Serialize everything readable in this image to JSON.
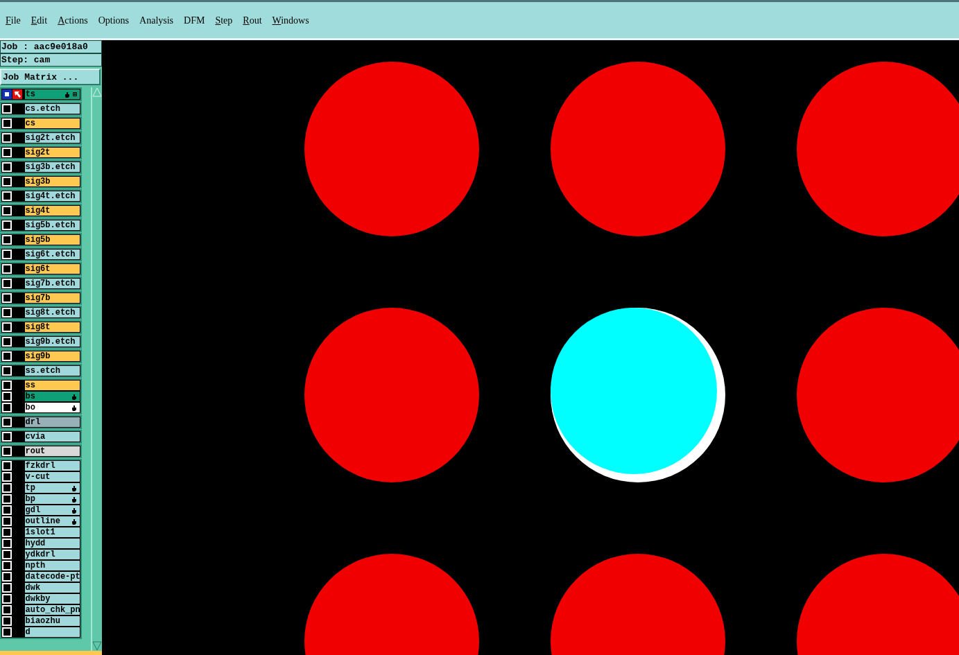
{
  "menu": [
    {
      "label": "File",
      "mnemonic": true
    },
    {
      "label": "Edit",
      "mnemonic": true
    },
    {
      "label": "Actions",
      "mnemonic": true
    },
    {
      "label": "Options",
      "mnemonic": false
    },
    {
      "label": "Analysis",
      "mnemonic": false
    },
    {
      "label": "DFM",
      "mnemonic": false
    },
    {
      "label": "Step",
      "mnemonic": true
    },
    {
      "label": "Rout",
      "mnemonic": true
    },
    {
      "label": "Windows",
      "mnemonic": true
    }
  ],
  "job": "Job : aac9e018a0",
  "step": "Step: cam",
  "matrix_button": "Job Matrix ...",
  "layer_groups": [
    {
      "layers": [
        {
          "name": "ts",
          "color": "#10a078",
          "work_layer": true,
          "hand": true
        }
      ]
    },
    {
      "layers": [
        {
          "name": "cs.etch",
          "color": "#a0d8dc",
          "work_layer": false,
          "hand": false
        }
      ]
    },
    {
      "layers": [
        {
          "name": "cs",
          "color": "#ffc850",
          "work_layer": false,
          "hand": false
        }
      ]
    },
    {
      "layers": [
        {
          "name": "sig2t.etch",
          "color": "#a0d8dc",
          "work_layer": false,
          "hand": false
        }
      ]
    },
    {
      "layers": [
        {
          "name": "sig2t",
          "color": "#ffc850",
          "work_layer": false,
          "hand": false
        }
      ]
    },
    {
      "layers": [
        {
          "name": "sig3b.etch",
          "color": "#a0d8dc",
          "work_layer": false,
          "hand": false
        }
      ]
    },
    {
      "layers": [
        {
          "name": "sig3b",
          "color": "#ffc850",
          "work_layer": false,
          "hand": false
        }
      ]
    },
    {
      "layers": [
        {
          "name": "sig4t.etch",
          "color": "#a0d8dc",
          "work_layer": false,
          "hand": false
        }
      ]
    },
    {
      "layers": [
        {
          "name": "sig4t",
          "color": "#ffc850",
          "work_layer": false,
          "hand": false
        }
      ]
    },
    {
      "layers": [
        {
          "name": "sig5b.etch",
          "color": "#a0d8dc",
          "work_layer": false,
          "hand": false
        }
      ]
    },
    {
      "layers": [
        {
          "name": "sig5b",
          "color": "#ffc850",
          "work_layer": false,
          "hand": false
        }
      ]
    },
    {
      "layers": [
        {
          "name": "sig6t.etch",
          "color": "#a0d8dc",
          "work_layer": false,
          "hand": false
        }
      ]
    },
    {
      "layers": [
        {
          "name": "sig6t",
          "color": "#ffc850",
          "work_layer": false,
          "hand": false
        }
      ]
    },
    {
      "layers": [
        {
          "name": "sig7b.etch",
          "color": "#a0d8dc",
          "work_layer": false,
          "hand": false
        }
      ]
    },
    {
      "layers": [
        {
          "name": "sig7b",
          "color": "#ffc850",
          "work_layer": false,
          "hand": false
        }
      ]
    },
    {
      "layers": [
        {
          "name": "sig8t.etch",
          "color": "#a0d8dc",
          "work_layer": false,
          "hand": false
        }
      ]
    },
    {
      "layers": [
        {
          "name": "sig8t",
          "color": "#ffc850",
          "work_layer": false,
          "hand": false
        }
      ]
    },
    {
      "layers": [
        {
          "name": "sig9b.etch",
          "color": "#a0d8dc",
          "work_layer": false,
          "hand": false
        }
      ]
    },
    {
      "layers": [
        {
          "name": "sig9b",
          "color": "#ffc850",
          "work_layer": false,
          "hand": false
        }
      ]
    },
    {
      "layers": [
        {
          "name": "ss.etch",
          "color": "#a0d8dc",
          "work_layer": false,
          "hand": false
        }
      ]
    },
    {
      "layers": [
        {
          "name": "ss",
          "color": "#ffc850",
          "work_layer": false,
          "hand": false
        },
        {
          "name": "bs",
          "color": "#10a078",
          "work_layer": false,
          "hand": true
        },
        {
          "name": "bo",
          "color": "#ffffff",
          "work_layer": false,
          "hand": true
        }
      ]
    },
    {
      "layers": [
        {
          "name": "drl",
          "color": "#98b0b8",
          "work_layer": false,
          "hand": false
        }
      ]
    },
    {
      "layers": [
        {
          "name": "cvia",
          "color": "#a0d8dc",
          "work_layer": false,
          "hand": false
        }
      ]
    },
    {
      "layers": [
        {
          "name": "rout",
          "color": "#d8d8d8",
          "work_layer": false,
          "hand": false
        }
      ]
    },
    {
      "layers": [
        {
          "name": "fzkdrl",
          "color": "#a0d8dc",
          "work_layer": false,
          "hand": false
        },
        {
          "name": "v-cut",
          "color": "#a0d8dc",
          "work_layer": false,
          "hand": false
        },
        {
          "name": "tp",
          "color": "#a0d8dc",
          "work_layer": false,
          "hand": true
        },
        {
          "name": "bp",
          "color": "#a0d8dc",
          "work_layer": false,
          "hand": true
        },
        {
          "name": "gdl",
          "color": "#a0d8dc",
          "work_layer": false,
          "hand": true
        },
        {
          "name": "outline",
          "color": "#a0d8dc",
          "work_layer": false,
          "hand": true
        },
        {
          "name": "1slot1",
          "color": "#a0d8dc",
          "work_layer": false,
          "hand": false
        },
        {
          "name": "hydd",
          "color": "#a0d8dc",
          "work_layer": false,
          "hand": false
        },
        {
          "name": "ydkdrl",
          "color": "#a0d8dc",
          "work_layer": false,
          "hand": false
        },
        {
          "name": "npth",
          "color": "#a0d8dc",
          "work_layer": false,
          "hand": false
        },
        {
          "name": "datecode-pt",
          "color": "#a0d8dc",
          "work_layer": false,
          "hand": false
        },
        {
          "name": "dwk",
          "color": "#a0d8dc",
          "work_layer": false,
          "hand": false
        },
        {
          "name": "dwkby",
          "color": "#a0d8dc",
          "work_layer": false,
          "hand": false
        },
        {
          "name": "auto_chk_pn",
          "color": "#a0d8dc",
          "work_layer": false,
          "hand": false
        },
        {
          "name": "biaozhu",
          "color": "#a0d8dc",
          "work_layer": false,
          "hand": false
        },
        {
          "name": "d",
          "color": "#a0d8dc",
          "work_layer": false,
          "hand": false
        }
      ]
    }
  ],
  "canvas": {
    "pads": [
      {
        "selected": false
      },
      {
        "selected": false
      },
      {
        "selected": false
      },
      {
        "selected": false
      },
      {
        "selected": true
      },
      {
        "selected": false
      },
      {
        "selected": false
      },
      {
        "selected": false
      },
      {
        "selected": false
      }
    ]
  }
}
